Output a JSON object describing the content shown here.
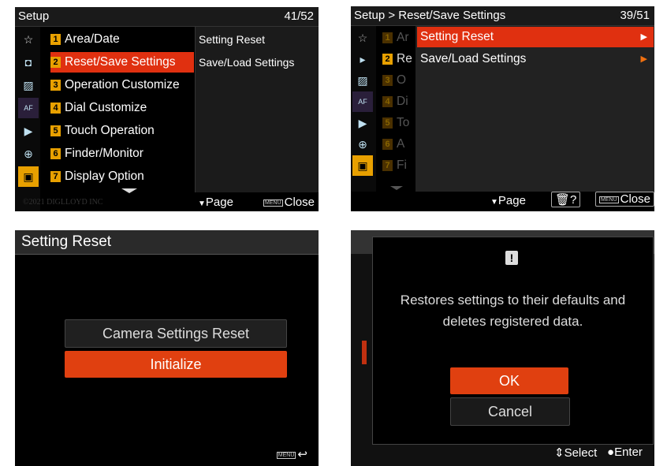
{
  "panel1": {
    "title": "Setup",
    "page": "41/52",
    "items": [
      {
        "num": "1",
        "label": "Area/Date"
      },
      {
        "num": "2",
        "label": "Reset/Save Settings"
      },
      {
        "num": "3",
        "label": "Operation Customize"
      },
      {
        "num": "4",
        "label": "Dial Customize"
      },
      {
        "num": "5",
        "label": "Touch Operation"
      },
      {
        "num": "6",
        "label": "Finder/Monitor"
      },
      {
        "num": "7",
        "label": "Display Option"
      }
    ],
    "submenu": [
      "Setting Reset",
      "Save/Load Settings"
    ],
    "watermark": "©2021 DIGLLOYD INC",
    "footer_page": "Page",
    "footer_close": "Close",
    "menu_key": "MENU"
  },
  "panel2": {
    "breadcrumb": "Setup > Reset/Save Settings",
    "page": "39/51",
    "items": [
      {
        "num": "1",
        "label": "Ar"
      },
      {
        "num": "2",
        "label": "Re"
      },
      {
        "num": "3",
        "label": "O"
      },
      {
        "num": "4",
        "label": "Di"
      },
      {
        "num": "5",
        "label": "To"
      },
      {
        "num": "6",
        "label": "A"
      },
      {
        "num": "7",
        "label": "Fi"
      }
    ],
    "submenu": [
      "Setting Reset",
      "Save/Load Settings"
    ],
    "footer_page": "Page",
    "footer_help": "?",
    "footer_close": "Close",
    "menu_key": "MENU"
  },
  "panel3": {
    "title": "Setting Reset",
    "options": [
      "Camera Settings Reset",
      "Initialize"
    ],
    "menu_key": "MENU"
  },
  "panel4": {
    "alert_icon": "!",
    "message_line1": "Restores settings to their defaults and",
    "message_line2": "deletes registered data.",
    "ok": "OK",
    "cancel": "Cancel",
    "footer_select": "Select",
    "footer_enter": "Enter"
  },
  "colors": {
    "highlight": "#e03010",
    "number_badge": "#e8a000",
    "arrow": "#f07010"
  }
}
